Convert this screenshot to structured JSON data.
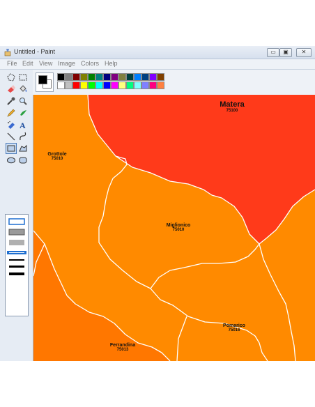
{
  "window": {
    "title": "Untitled - Paint",
    "min_glyph": "▭",
    "max_glyph": "▣",
    "close_glyph": "✕"
  },
  "menu": [
    "File",
    "Edit",
    "View",
    "Image",
    "Colors",
    "Help"
  ],
  "palette": {
    "row1": [
      "#000000",
      "#808080",
      "#800000",
      "#808000",
      "#008000",
      "#008080",
      "#000080",
      "#800080",
      "#808040",
      "#004040",
      "#0080ff",
      "#004080",
      "#8000ff",
      "#804000"
    ],
    "row2": [
      "#ffffff",
      "#c0c0c0",
      "#ff0000",
      "#ffff00",
      "#00ff00",
      "#00ffff",
      "#0000ff",
      "#ff00ff",
      "#ffff80",
      "#00ff80",
      "#80ffff",
      "#8080ff",
      "#ff0080",
      "#ff8040"
    ]
  },
  "map": {
    "colors": {
      "matera": "#ff3a1a",
      "region": "#ff8a00",
      "lower": "#ff7700",
      "border": "#ffffff"
    },
    "places": [
      {
        "name": "Matera",
        "cap": "75100"
      },
      {
        "name": "Grottole",
        "cap": "75010"
      },
      {
        "name": "Miglionico",
        "cap": "75010"
      },
      {
        "name": "Pomarico",
        "cap": "75016"
      },
      {
        "name": "Ferrandina",
        "cap": "75013"
      }
    ]
  }
}
